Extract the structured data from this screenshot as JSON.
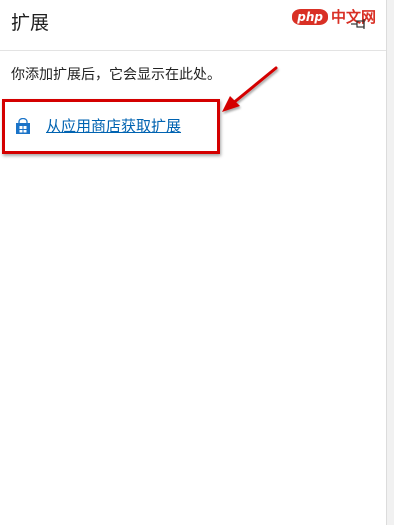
{
  "panel": {
    "title": "扩展",
    "description": "你添加扩展后，它会显示在此处。",
    "store_link_label": "从应用商店获取扩展"
  },
  "watermark": {
    "logo": "php",
    "text": "中文网"
  },
  "icons": {
    "pin": "pin-icon",
    "store": "store-bag-icon"
  },
  "colors": {
    "link": "#0063b1",
    "highlight": "#d40000",
    "watermark": "#d93025"
  }
}
